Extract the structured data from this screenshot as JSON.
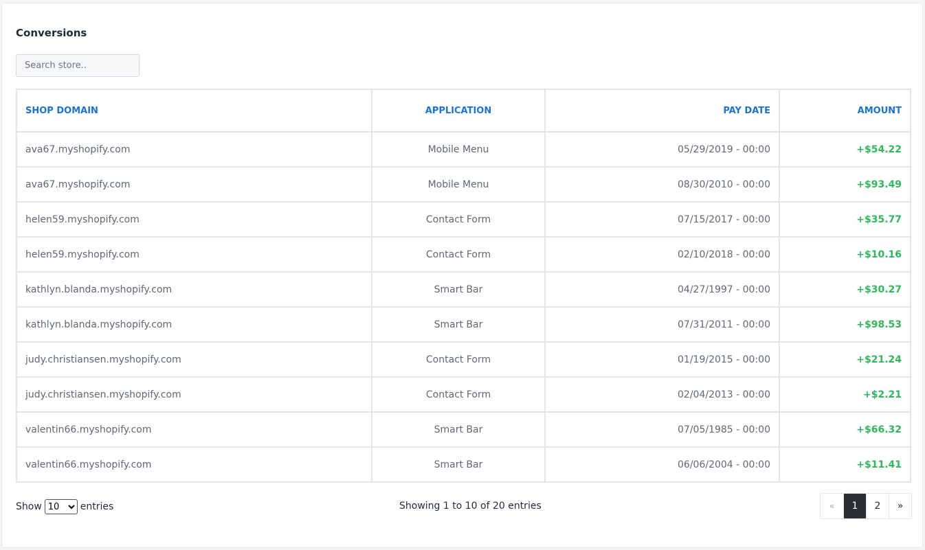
{
  "title": "Conversions",
  "search": {
    "placeholder": "Search store.."
  },
  "table": {
    "headers": {
      "shop": "SHOP DOMAIN",
      "app": "APPLICATION",
      "date": "PAY DATE",
      "amount": "AMOUNT"
    },
    "rows": [
      {
        "shop": "ava67.myshopify.com",
        "app": "Mobile Menu",
        "date": "05/29/2019 - 00:00",
        "amount": "+$54.22"
      },
      {
        "shop": "ava67.myshopify.com",
        "app": "Mobile Menu",
        "date": "08/30/2010 - 00:00",
        "amount": "+$93.49"
      },
      {
        "shop": "helen59.myshopify.com",
        "app": "Contact Form",
        "date": "07/15/2017 - 00:00",
        "amount": "+$35.77"
      },
      {
        "shop": "helen59.myshopify.com",
        "app": "Contact Form",
        "date": "02/10/2018 - 00:00",
        "amount": "+$10.16"
      },
      {
        "shop": "kathlyn.blanda.myshopify.com",
        "app": "Smart Bar",
        "date": "04/27/1997 - 00:00",
        "amount": "+$30.27"
      },
      {
        "shop": "kathlyn.blanda.myshopify.com",
        "app": "Smart Bar",
        "date": "07/31/2011 - 00:00",
        "amount": "+$98.53"
      },
      {
        "shop": "judy.christiansen.myshopify.com",
        "app": "Contact Form",
        "date": "01/19/2015 - 00:00",
        "amount": "+$21.24"
      },
      {
        "shop": "judy.christiansen.myshopify.com",
        "app": "Contact Form",
        "date": "02/04/2013 - 00:00",
        "amount": "+$2.21"
      },
      {
        "shop": "valentin66.myshopify.com",
        "app": "Smart Bar",
        "date": "07/05/1985 - 00:00",
        "amount": "+$66.32"
      },
      {
        "shop": "valentin66.myshopify.com",
        "app": "Smart Bar",
        "date": "06/06/2004 - 00:00",
        "amount": "+$11.41"
      }
    ]
  },
  "footer": {
    "show_label": "Show",
    "entries_value": "10",
    "entries_label": "entries",
    "summary": "Showing 1 to 10 of 20 entries",
    "pagination": {
      "prev": "«",
      "pages": [
        "1",
        "2"
      ],
      "active": "1",
      "next": "»"
    }
  },
  "colors": {
    "header_text": "#1a73d9",
    "amount_text": "#2eb85c",
    "active_page_bg": "#2b2f33"
  }
}
